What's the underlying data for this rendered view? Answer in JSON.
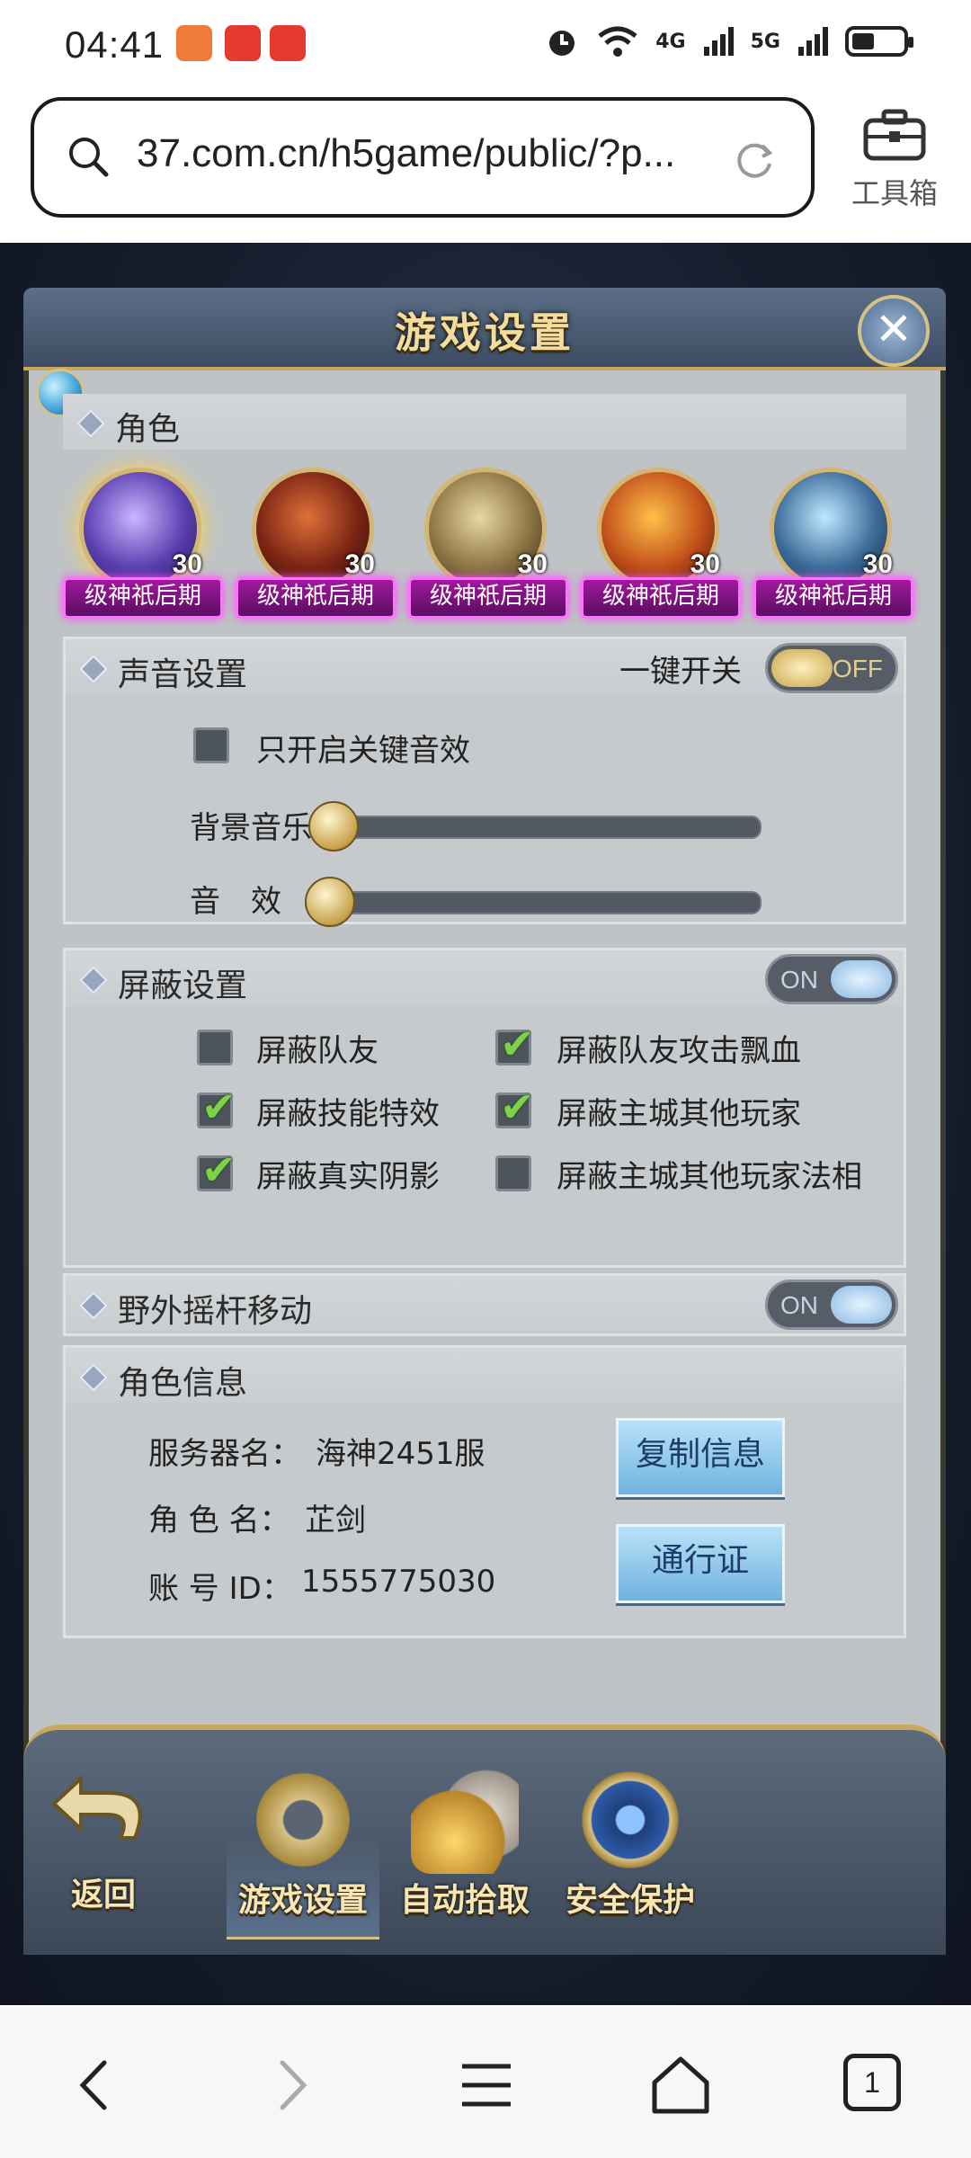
{
  "status_bar": {
    "time": "04:41",
    "network_4g": "4G",
    "network_5g": "5G"
  },
  "browser": {
    "url": "37.com.cn/h5game/public/?p...",
    "toolbox_label": "工具箱",
    "tabs_count": "1"
  },
  "dialog": {
    "title": "游戏设置",
    "close_icon": "close-icon"
  },
  "roles": {
    "title": "角色",
    "avatars": [
      {
        "level": "30",
        "banner": "级神祇后期"
      },
      {
        "level": "30",
        "banner": "级神祇后期"
      },
      {
        "level": "30",
        "banner": "级神祇后期"
      },
      {
        "level": "30",
        "banner": "级神祇后期"
      },
      {
        "level": "30",
        "banner": "级神祇后期"
      }
    ]
  },
  "sound": {
    "title": "声音设置",
    "master_label": "一键开关",
    "master_state": "OFF",
    "key_only_label": "只开启关键音效",
    "key_only_checked": false,
    "bgm_label": "背景音乐",
    "bgm_level": 0,
    "sfx_label": "音　效",
    "sfx_level": 0
  },
  "block": {
    "title": "屏蔽设置",
    "state": "ON",
    "options": [
      {
        "label": "屏蔽队友",
        "checked": false
      },
      {
        "label": "屏蔽队友攻击飘血",
        "checked": true
      },
      {
        "label": "屏蔽技能特效",
        "checked": true
      },
      {
        "label": "屏蔽主城其他玩家",
        "checked": true
      },
      {
        "label": "屏蔽真实阴影",
        "checked": true
      },
      {
        "label": "屏蔽主城其他玩家法相",
        "checked": false
      }
    ]
  },
  "joystick": {
    "title": "野外摇杆移动",
    "state": "ON"
  },
  "role_info": {
    "title": "角色信息",
    "server_label": "服务器名：",
    "server_value": "海神2451服",
    "name_label": "角 色 名：",
    "name_value": "芷剑",
    "account_label": "账 号 ID：",
    "account_value": "1555775030",
    "copy_button": "复制信息",
    "pass_button": "通行证"
  },
  "bottom_nav": {
    "back": "返回",
    "items": [
      "游戏设置",
      "自动拾取",
      "安全保护"
    ]
  }
}
